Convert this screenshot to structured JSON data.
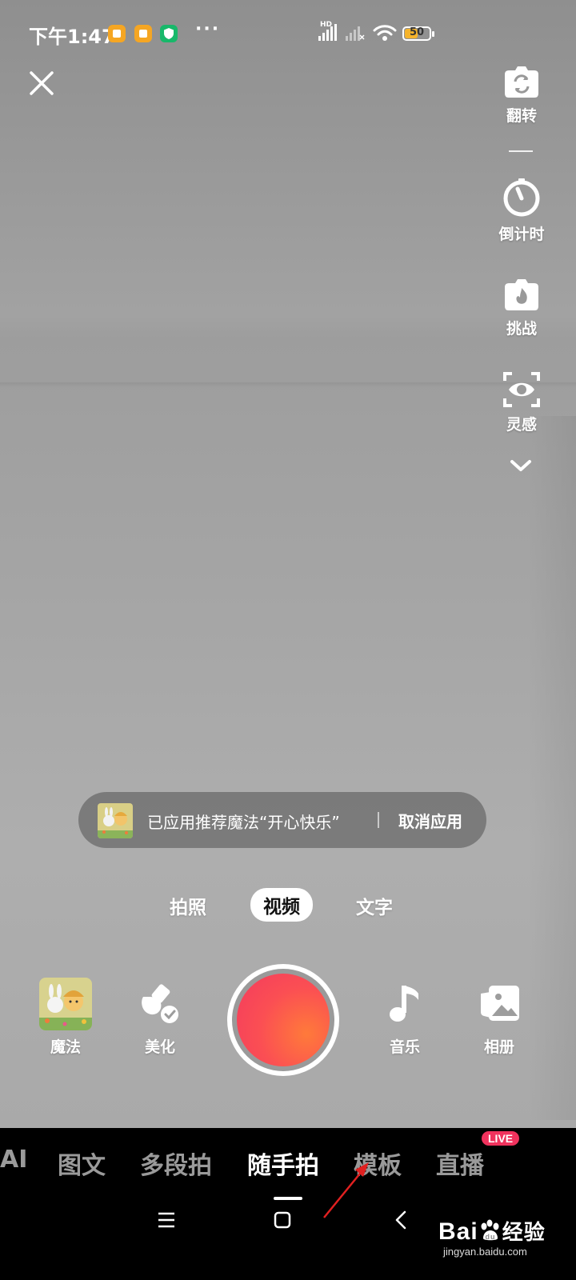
{
  "status_bar": {
    "time": "下午1:47",
    "hd_label": "HD",
    "battery_level": "50",
    "colors": {
      "notif_orange": "#f5a623",
      "notif_green": "#18b86a",
      "battery_fill": "#f5b32b"
    }
  },
  "right_rail": [
    {
      "label": "翻转",
      "icon": "flip-camera-icon"
    },
    {
      "label": "倒计时",
      "icon": "timer-icon"
    },
    {
      "label": "挑战",
      "icon": "challenge-flame-icon"
    },
    {
      "label": "灵感",
      "icon": "inspiration-eye-icon"
    }
  ],
  "toast": {
    "message": "已应用推荐魔法“开心快乐”",
    "cancel_label": "取消应用"
  },
  "modes": {
    "photo": "拍照",
    "video": "视频",
    "text": "文字",
    "active": "视频"
  },
  "tools": {
    "magic": "魔法",
    "beautify": "美化",
    "music": "音乐",
    "album": "相册"
  },
  "shutter": {
    "colors": [
      "#f33b5e",
      "#ff7a3a"
    ]
  },
  "nav": {
    "items": [
      "AI",
      "图文",
      "多段拍",
      "随手拍",
      "模板",
      "直播"
    ],
    "active": "随手拍",
    "live_badge": "LIVE"
  },
  "watermark": {
    "brand": "Bai",
    "brand_cn": "经验",
    "url": "jingyan.baidu.com"
  }
}
